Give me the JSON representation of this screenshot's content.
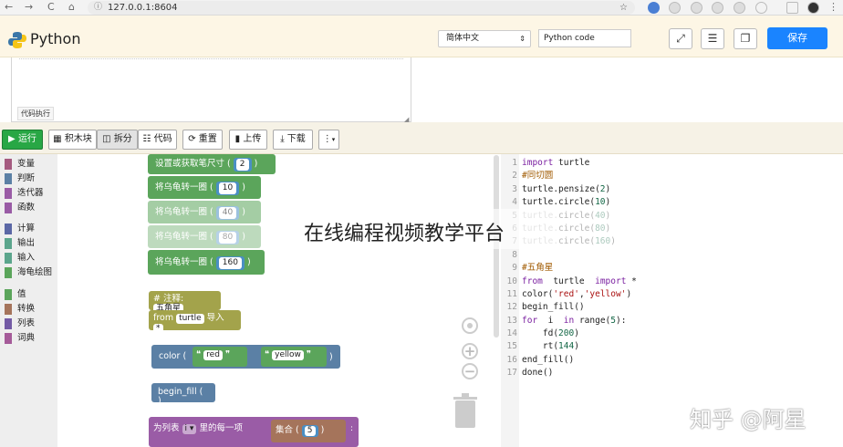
{
  "browser": {
    "url": "127.0.0.1:8604",
    "back": "←",
    "forward": "→",
    "reload": "C",
    "home": "⌂"
  },
  "header": {
    "title": "Python",
    "language_select": "简体中文",
    "mode_input": "Python code",
    "save_label": "保存"
  },
  "textarea": {
    "run_label": "代码执行"
  },
  "toolbar": {
    "run": "运行",
    "blocks": "积木块",
    "split": "拆分",
    "code": "代码",
    "reset": "重置",
    "upload": "上传",
    "download": "下载",
    "more": "⋮"
  },
  "categories": [
    {
      "label": "变量",
      "color": "#a55b80"
    },
    {
      "label": "判断",
      "color": "#5b80a5"
    },
    {
      "label": "迭代器",
      "color": "#9a5ca6"
    },
    {
      "label": "函数",
      "color": "#995ba5"
    },
    {
      "label": "计算",
      "color": "#5b67a5"
    },
    {
      "label": "输出",
      "color": "#5ba58c"
    },
    {
      "label": "输入",
      "color": "#5ba58c"
    },
    {
      "label": "海龟绘图",
      "color": "#5ba55b"
    },
    {
      "label": "值",
      "color": "#5ba55b"
    },
    {
      "label": "转换",
      "color": "#a5745b"
    },
    {
      "label": "列表",
      "color": "#745ba5"
    },
    {
      "label": "词典",
      "color": "#a55b99"
    }
  ],
  "blocks": {
    "pensize": {
      "label": "设置或获取笔尺寸",
      "value": "2"
    },
    "circles": [
      {
        "label": "将乌龟转一圈",
        "value": "10"
      },
      {
        "label": "将乌龟转一圈",
        "value": "40"
      },
      {
        "label": "将乌龟转一圈",
        "value": "80"
      },
      {
        "label": "将乌龟转一圈",
        "value": "160"
      }
    ],
    "comment": {
      "prefix": "#",
      "label": "注释:",
      "value": "五角星"
    },
    "import": {
      "from": "from",
      "module": "turtle",
      "import": "导入",
      "star": "*"
    },
    "color": {
      "label": "color",
      "arg1": "red",
      "arg2": "yellow",
      "quote_open": "❝",
      "quote_close": "❞"
    },
    "begin_fill": {
      "label": "begin_fill"
    },
    "for": {
      "label": "为列表",
      "var": "i",
      "each": "里的每一项",
      "set_label": "集合",
      "set_value": "5"
    },
    "paren_open": "(",
    "paren_close": ")"
  },
  "code": {
    "line_numbers": [
      "1",
      "2",
      "3",
      "4",
      "5",
      "6",
      "7",
      "8",
      "9",
      "10",
      "11",
      "12",
      "13",
      "14",
      "15",
      "16",
      "17"
    ]
  },
  "watermark": "在线编程视频教学平台",
  "credit": "知乎 @阿星"
}
